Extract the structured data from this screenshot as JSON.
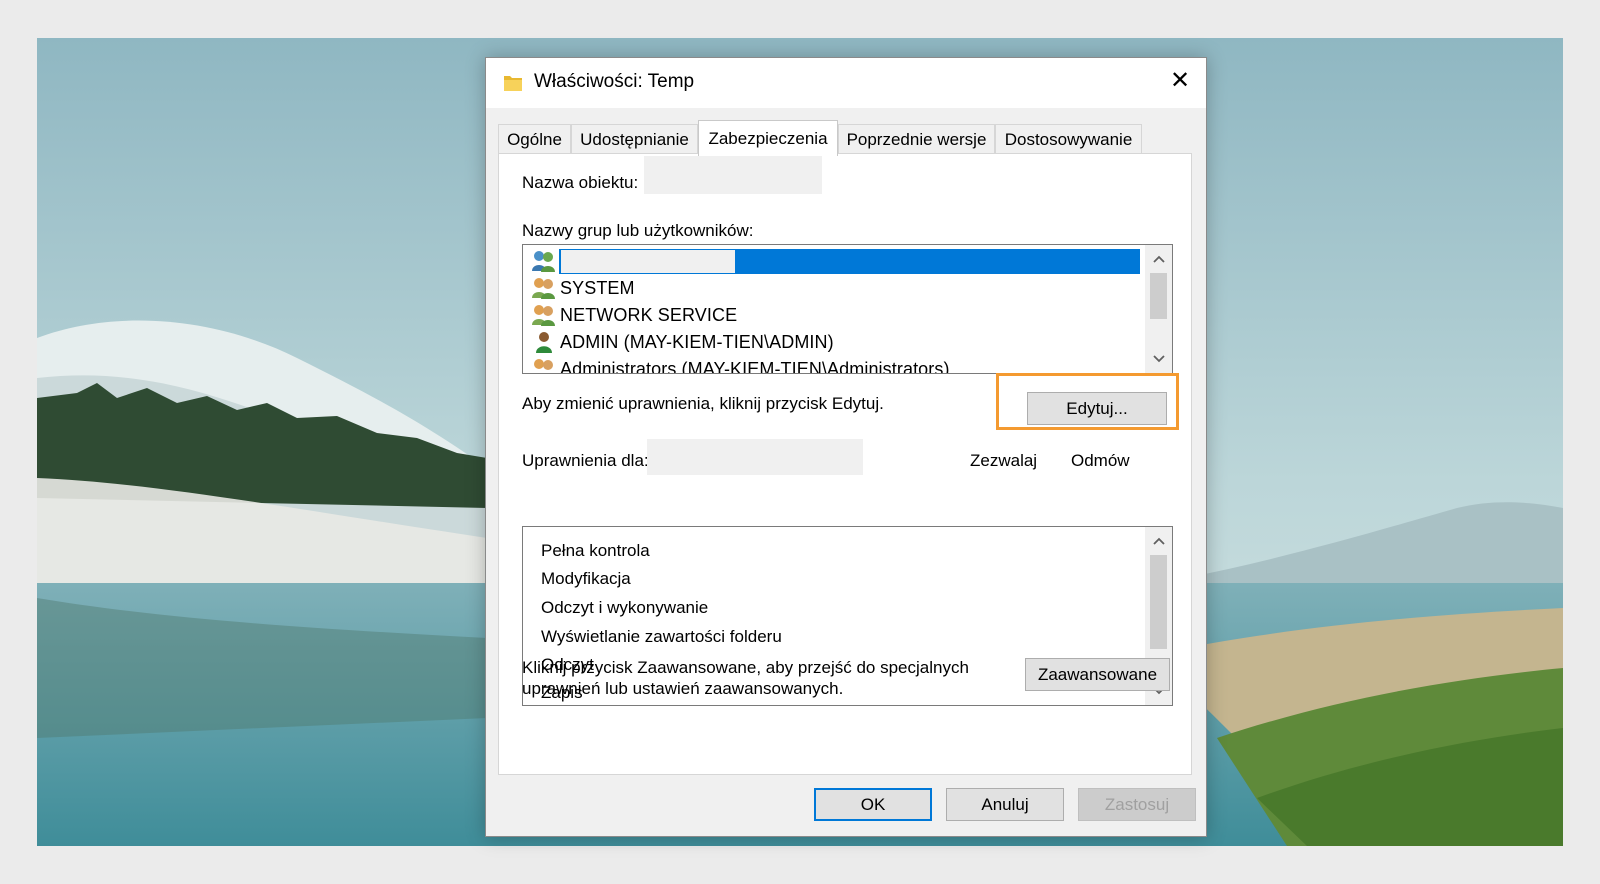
{
  "window": {
    "title": "Właściwości: Temp",
    "close_glyph": "✕",
    "icon": "folder-icon"
  },
  "tabs": [
    {
      "label": "Ogólne",
      "active": false
    },
    {
      "label": "Udostępnianie",
      "active": false
    },
    {
      "label": "Zabezpieczenia",
      "active": true
    },
    {
      "label": "Poprzednie wersje",
      "active": false
    },
    {
      "label": "Dostosowywanie",
      "active": false
    }
  ],
  "security": {
    "object_name_label": "Nazwa obiektu:",
    "groups_label": "Nazwy grup lub użytkowników:",
    "users": [
      {
        "name": "",
        "icon": "group-users-icon",
        "selected": true
      },
      {
        "name": "SYSTEM",
        "icon": "group-users-icon",
        "selected": false
      },
      {
        "name": "NETWORK SERVICE",
        "icon": "group-users-icon",
        "selected": false
      },
      {
        "name": "ADMIN (MAY-KIEM-TIEN\\ADMIN)",
        "icon": "user-icon",
        "selected": false
      },
      {
        "name": "Administrators (MAY-KIEM-TIEN\\Administrators)",
        "icon": "group-users-icon",
        "selected": false
      }
    ],
    "edit_hint": "Aby zmienić uprawnienia, kliknij przycisk Edytuj.",
    "edit_button": "Edytuj...",
    "permissions_for_label": "Uprawnienia dla:",
    "allow_header": "Zezwalaj",
    "deny_header": "Odmów",
    "permissions": [
      "Pełna kontrola",
      "Modyfikacja",
      "Odczyt i wykonywanie",
      "Wyświetlanie zawartości folderu",
      "Odczyt",
      "Zapis"
    ],
    "advanced_hint_line1": "Kliknij przycisk Zaawansowane, aby przejść do specjalnych",
    "advanced_hint_line2": "uprawnień lub ustawień zaawansowanych.",
    "advanced_button": "Zaawansowane"
  },
  "footer": {
    "ok": "OK",
    "cancel": "Anuluj",
    "apply": "Zastosuj"
  },
  "colors": {
    "selection": "#0078d7",
    "highlight_box": "#f49a30",
    "dialog_bg": "#f0f0f0"
  }
}
